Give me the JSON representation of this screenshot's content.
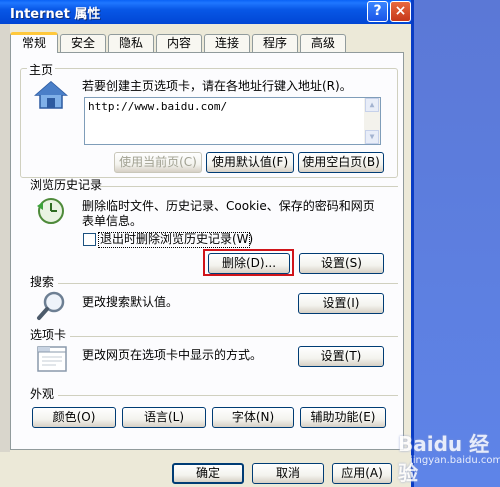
{
  "window": {
    "title": "Internet 属性"
  },
  "titlebar": {
    "help": "?",
    "close": "×"
  },
  "tabs": [
    {
      "label": "常规",
      "active": true
    },
    {
      "label": "安全"
    },
    {
      "label": "隐私"
    },
    {
      "label": "内容"
    },
    {
      "label": "连接"
    },
    {
      "label": "程序"
    },
    {
      "label": "高级"
    }
  ],
  "home": {
    "section_label": "主页",
    "description": "若要创建主页选项卡，请在各地址行键入地址(R)。",
    "url": "http://www.baidu.com/",
    "btn_use_current": "使用当前页(C)",
    "btn_use_default": "使用默认值(F)",
    "btn_use_blank": "使用空白页(B)"
  },
  "history": {
    "section_label": "浏览历史记录",
    "description_line1": "删除临时文件、历史记录、Cookie、保存的密码和网页",
    "description_line2": "表单信息。",
    "checkbox_label": "退出时删除浏览历史记录(W)",
    "btn_delete": "删除(D)...",
    "btn_settings": "设置(S)"
  },
  "search": {
    "section_label": "搜索",
    "description": "更改搜索默认值。",
    "btn_settings": "设置(I)"
  },
  "tabs_section": {
    "section_label": "选项卡",
    "description": "更改网页在选项卡中显示的方式。",
    "btn_settings": "设置(T)"
  },
  "appearance": {
    "section_label": "外观",
    "btn_colors": "颜色(O)",
    "btn_languages": "语言(L)",
    "btn_fonts": "字体(N)",
    "btn_accessibility": "辅助功能(E)"
  },
  "footer": {
    "btn_ok": "确定",
    "btn_cancel": "取消",
    "btn_apply": "应用(A)"
  },
  "watermark": {
    "text": "Baidu 经验",
    "sub": "jingyan.baidu.com"
  },
  "colors": {
    "title_bar": "#0a5ae6",
    "highlight_box": "#d0141a",
    "dialog_bg": "#ece9d8"
  }
}
